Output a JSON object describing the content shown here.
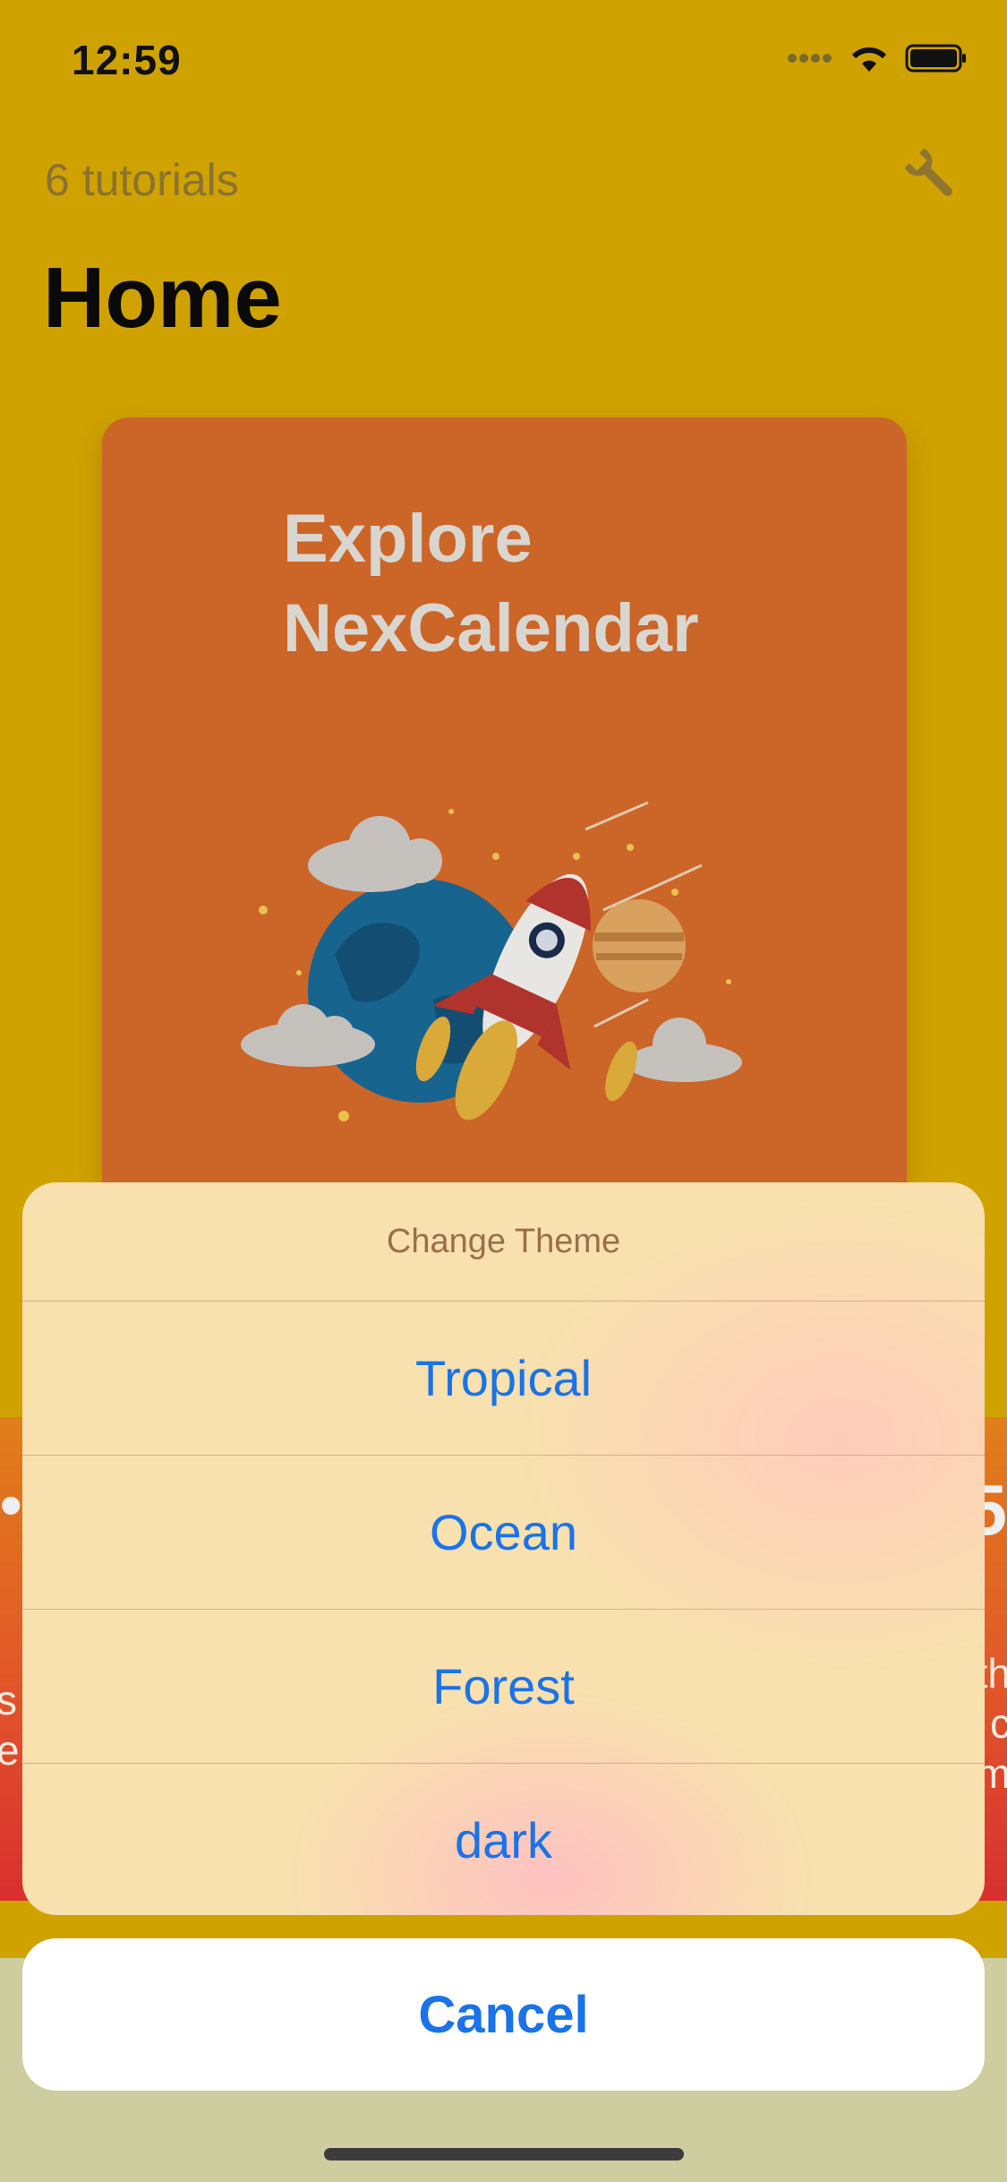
{
  "status_bar": {
    "time": "12:59"
  },
  "header": {
    "subtitle": "6 tutorials",
    "title": "Home"
  },
  "card": {
    "title": "Explore NexCalendar"
  },
  "background_peek": {
    "left_heading": "•",
    "left_text": "s\ne",
    "right_heading": "5",
    "right_text": "th\ns c\nm"
  },
  "action_sheet": {
    "title": "Change Theme",
    "options": [
      "Tropical",
      "Ocean",
      "Forest",
      "dark"
    ],
    "cancel_label": "Cancel"
  },
  "colors": {
    "background": "#cfa200",
    "card": "#cc6528",
    "accent": "#1a73e8",
    "sheet": "#f8e1ae"
  },
  "icons": [
    "signal-icon",
    "wifi-icon",
    "battery-icon",
    "wrench-icon"
  ]
}
